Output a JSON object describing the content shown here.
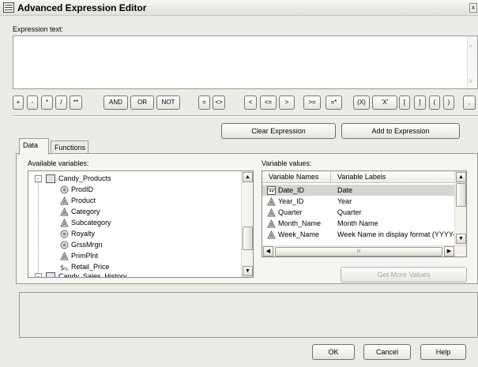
{
  "window": {
    "title": "Advanced Expression Editor",
    "close_glyph": "x"
  },
  "expression": {
    "label": "Expression text:",
    "value": "",
    "scroll_up": "^",
    "scroll_down": "v"
  },
  "operators": [
    "+",
    "-",
    "*",
    "/",
    "**",
    "AND",
    "OR",
    "NOT",
    "=",
    "<>",
    "<",
    "<=",
    ">",
    ">=",
    "=*",
    "(X)",
    "'X'",
    "[",
    "]",
    "(",
    ")",
    ","
  ],
  "actions": {
    "clear": "Clear Expression",
    "add": "Add to Expression"
  },
  "tabs": [
    {
      "label": "Data"
    },
    {
      "label": "Functions"
    }
  ],
  "available": {
    "label": "Available variables:",
    "root": "Candy_Products",
    "items": [
      {
        "name": "ProdID",
        "icon": "numeric-column-icon"
      },
      {
        "name": "Product",
        "icon": "character-column-icon"
      },
      {
        "name": "Category",
        "icon": "character-column-icon"
      },
      {
        "name": "Subcategory",
        "icon": "character-column-icon"
      },
      {
        "name": "Royalty",
        "icon": "numeric-column-icon"
      },
      {
        "name": "GrssMrgn",
        "icon": "numeric-column-icon"
      },
      {
        "name": "PrimPlnt",
        "icon": "character-column-icon"
      },
      {
        "name": "Retail_Price",
        "icon": "currency-column-icon"
      }
    ],
    "root2": "Candy_Sales_History"
  },
  "variable_values": {
    "label": "Variable values:",
    "col_names": "Variable Names",
    "col_labels": "Variable Labels",
    "rows": [
      {
        "name": "Date_ID",
        "label": "Date",
        "icon": "date-column-icon"
      },
      {
        "name": "Year_ID",
        "label": "Year",
        "icon": "character-column-icon"
      },
      {
        "name": "Quarter",
        "label": "Quarter",
        "icon": "character-column-icon"
      },
      {
        "name": "Month_Name",
        "label": "Month Name",
        "icon": "character-column-icon"
      },
      {
        "name": "Week_Name",
        "label": "Week Name in display format (YYYY-",
        "icon": "character-column-icon"
      }
    ],
    "hscroll_grip": "III"
  },
  "get_more": "Get More Values",
  "dialog": {
    "ok": "OK",
    "cancel": "Cancel",
    "help": "Help"
  },
  "colors": {
    "selection": "#d6d5cf",
    "face": "#ecebe6",
    "border": "#8a8a8a"
  }
}
